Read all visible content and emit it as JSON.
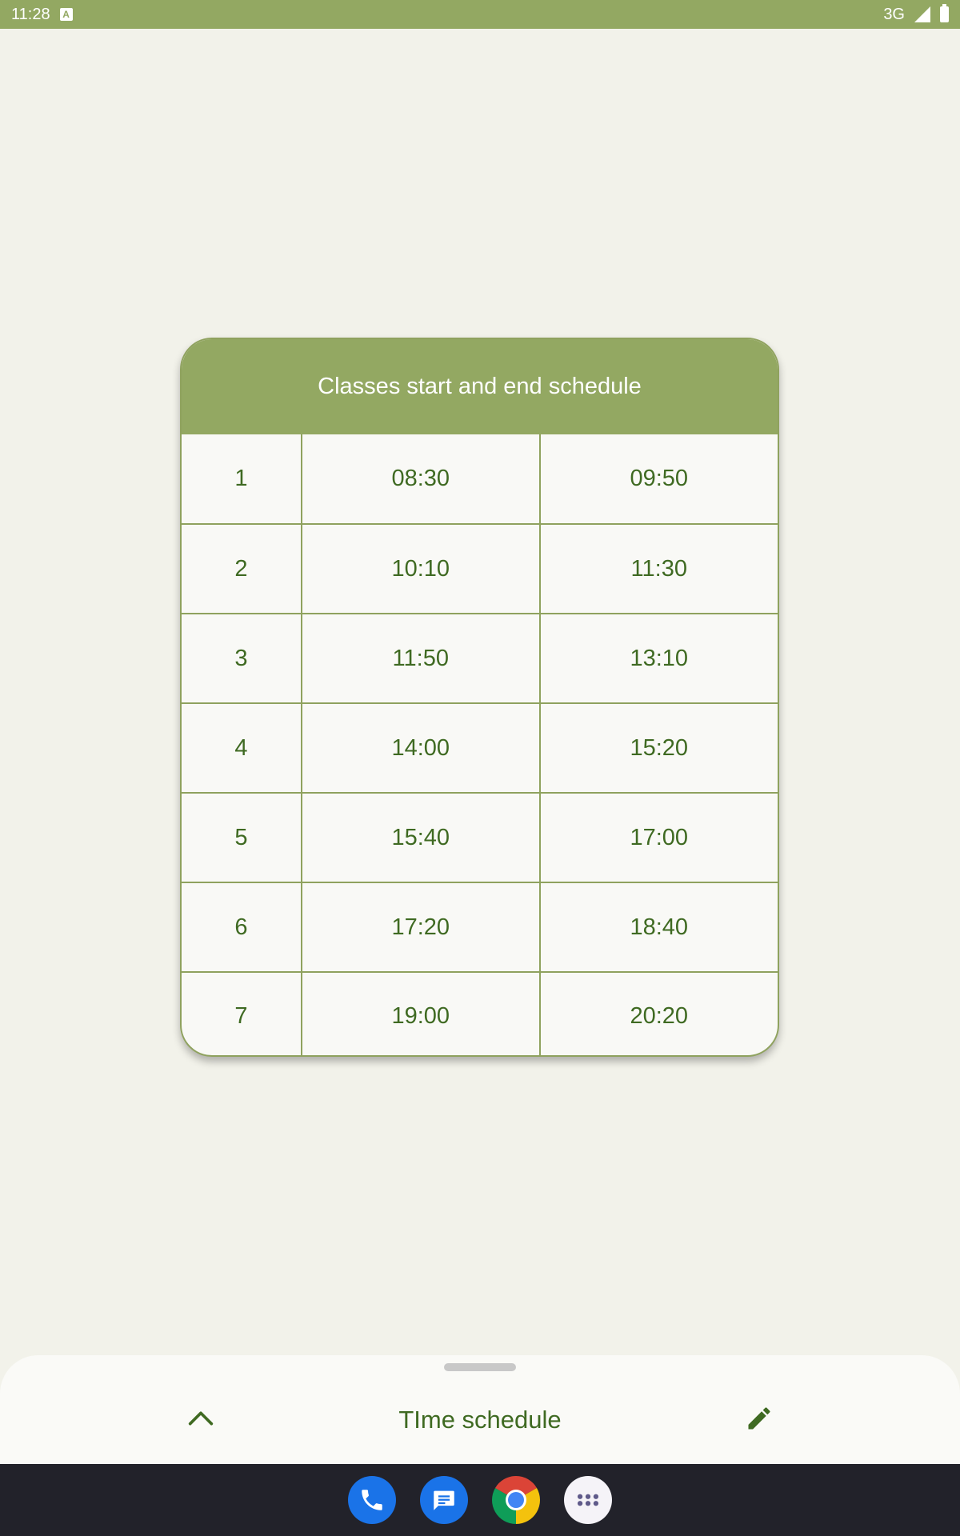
{
  "status_bar": {
    "time": "11:28",
    "notification_icon": "a-icon",
    "network": "3G",
    "signal_icon": "signal-icon",
    "battery_icon": "battery-icon"
  },
  "schedule": {
    "title": "Classes start and end schedule",
    "rows": [
      {
        "number": "1",
        "start": "08:30",
        "end": "09:50"
      },
      {
        "number": "2",
        "start": "10:10",
        "end": "11:30"
      },
      {
        "number": "3",
        "start": "11:50",
        "end": "13:10"
      },
      {
        "number": "4",
        "start": "14:00",
        "end": "15:20"
      },
      {
        "number": "5",
        "start": "15:40",
        "end": "17:00"
      },
      {
        "number": "6",
        "start": "17:20",
        "end": "18:40"
      },
      {
        "number": "7",
        "start": "19:00",
        "end": "20:20"
      }
    ]
  },
  "bottom_sheet": {
    "title": "TIme schedule",
    "expand_icon": "chevron-up-icon",
    "edit_icon": "pencil-icon"
  },
  "dock": {
    "apps": [
      "phone-icon",
      "messages-icon",
      "chrome-icon",
      "app-drawer-icon"
    ]
  },
  "colors": {
    "primary": "#93a862",
    "text_green": "#3f6a22",
    "background": "#f2f2ea",
    "nav_bar": "#22222a"
  }
}
